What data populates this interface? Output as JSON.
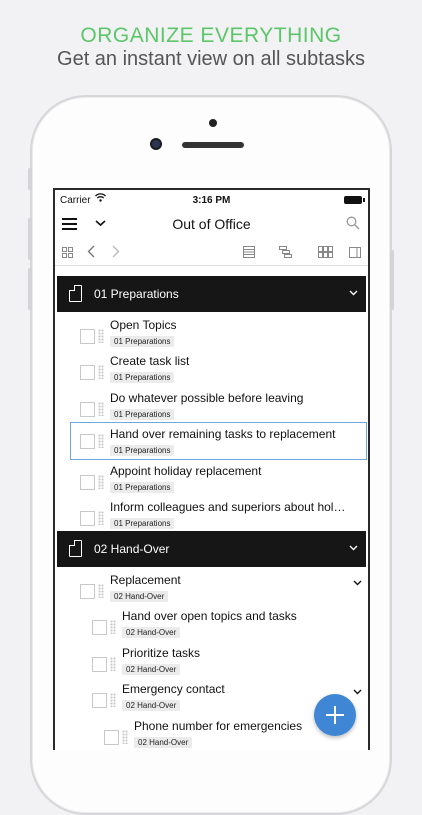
{
  "promo": {
    "title": "ORGANIZE EVERYTHING",
    "subtitle": "Get an instant view on all subtasks"
  },
  "status_bar": {
    "carrier": "Carrier",
    "time": "3:16 PM"
  },
  "nav": {
    "title": "Out of Office"
  },
  "sections": [
    {
      "label": "01 Preparations",
      "tasks": [
        {
          "name": "Open Topics",
          "tag": "01 Preparations"
        },
        {
          "name": "Create task list",
          "tag": "01 Preparations"
        },
        {
          "name": "Do whatever possible before leaving",
          "tag": "01 Preparations"
        },
        {
          "name": "Hand over remaining tasks to replacement",
          "tag": "01 Preparations"
        },
        {
          "name": "Appoint holiday replacement",
          "tag": "01 Preparations"
        },
        {
          "name": "Inform colleagues and superiors about hol…",
          "tag": "01 Preparations"
        }
      ]
    },
    {
      "label": "02 Hand-Over",
      "tasks": [
        {
          "name": "Replacement",
          "tag": "02 Hand-Over"
        },
        {
          "name": "Hand over open topics and tasks",
          "tag": "02 Hand-Over"
        },
        {
          "name": "Prioritize tasks",
          "tag": "02 Hand-Over"
        },
        {
          "name": "Emergency contact",
          "tag": "02 Hand-Over"
        },
        {
          "name": "Phone number for emergencies",
          "tag": "02 Hand-Over"
        }
      ]
    }
  ],
  "colors": {
    "accent_green": "#5cc66a",
    "section_bg": "#161616",
    "fab": "#3f86d4",
    "selection": "#6ea6e0"
  },
  "icons": {
    "menu": "hamburger-icon",
    "dropdown": "chevron-down-icon",
    "search": "search-icon",
    "fab": "plus-icon"
  }
}
